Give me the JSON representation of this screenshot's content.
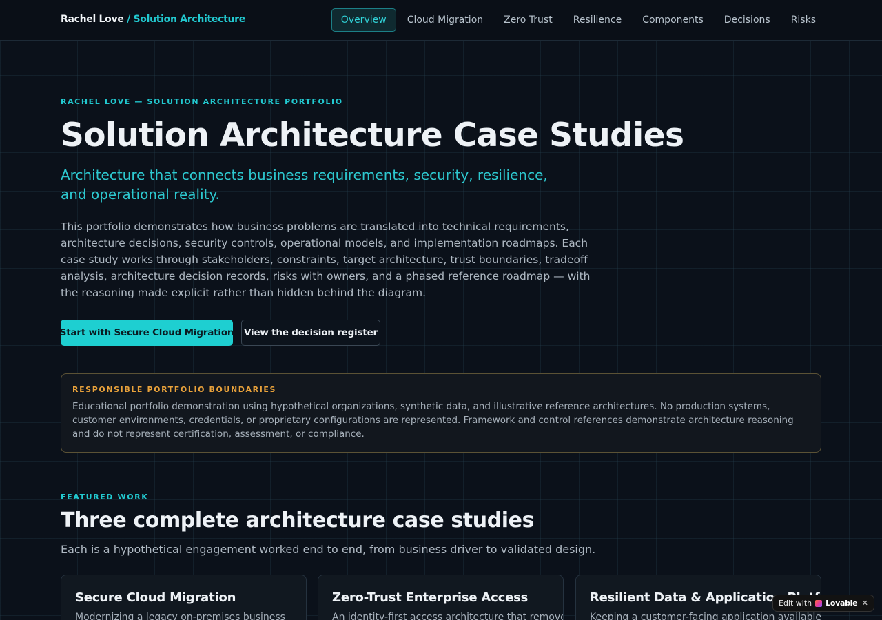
{
  "header": {
    "brand_name": "Rachel Love",
    "brand_sub": "/ Solution Architecture",
    "nav": [
      {
        "label": "Overview"
      },
      {
        "label": "Cloud Migration"
      },
      {
        "label": "Zero Trust"
      },
      {
        "label": "Resilience"
      },
      {
        "label": "Components"
      },
      {
        "label": "Decisions"
      },
      {
        "label": "Risks"
      }
    ],
    "active_nav": "Overview"
  },
  "hero": {
    "eyebrow": "RACHEL LOVE — SOLUTION ARCHITECTURE PORTFOLIO",
    "title": "Solution Architecture Case Studies",
    "subtitle": "Architecture that connects business requirements, security, resilience, and operational reality.",
    "body": "This portfolio demonstrates how business problems are translated into technical requirements, architecture decisions, security controls, operational models, and implementation roadmaps. Each case study works through stakeholders, constraints, target architecture, trust boundaries, tradeoff analysis, architecture decision records, risks with owners, and a phased reference roadmap — with the reasoning made explicit rather than hidden behind the diagram.",
    "primary_cta": "Start with Secure Cloud Migration",
    "secondary_cta": "View the decision register"
  },
  "notice": {
    "title": "RESPONSIBLE PORTFOLIO BOUNDARIES",
    "body": "Educational portfolio demonstration using hypothetical organizations, synthetic data, and illustrative reference architectures. No production systems, customer environments, credentials, or proprietary configurations are represented. Framework and control references demonstrate architecture reasoning and do not represent certification, assessment, or compliance."
  },
  "featured": {
    "eyebrow": "FEATURED WORK",
    "title": "Three complete architecture case studies",
    "subtitle": "Each is a hypothetical engagement worked end to end, from business driver to validated design.",
    "cards": [
      {
        "title": "Secure Cloud Migration",
        "desc": "Modernizing a legacy on-premises business"
      },
      {
        "title": "Zero-Trust Enterprise Access",
        "desc": "An identity-first access architecture that removes"
      },
      {
        "title": "Resilient Data & Application Platform",
        "desc": "Keeping a customer-facing application available"
      }
    ]
  },
  "badge": {
    "prefix": "Edit with",
    "brand": "Lovable",
    "close": "✕"
  },
  "colors": {
    "background": "#0b111a",
    "accent": "#22c9d0",
    "warning": "#e9a23b"
  }
}
